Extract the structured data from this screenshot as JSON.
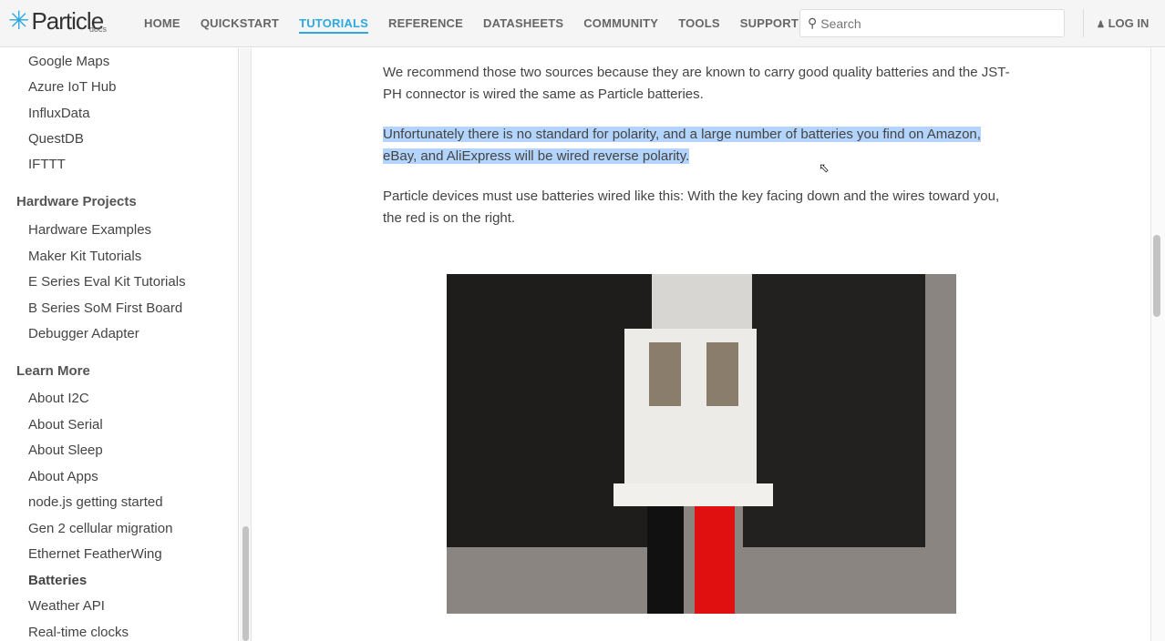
{
  "header": {
    "logo": "Particle",
    "logo_sub": "docs",
    "nav": [
      "HOME",
      "QUICKSTART",
      "TUTORIALS",
      "REFERENCE",
      "DATASHEETS",
      "COMMUNITY",
      "TOOLS",
      "SUPPORT"
    ],
    "active_nav": "TUTORIALS",
    "search_placeholder": "Search",
    "login": "LOG IN"
  },
  "sidebar": {
    "group1": [
      "Google Maps",
      "Azure IoT Hub",
      "InfluxData",
      "QuestDB",
      "IFTTT"
    ],
    "hardware_heading": "Hardware Projects",
    "hardware": [
      "Hardware Examples",
      "Maker Kit Tutorials",
      "E Series Eval Kit Tutorials",
      "B Series SoM First Board",
      "Debugger Adapter"
    ],
    "learn_heading": "Learn More",
    "learn": [
      "About I2C",
      "About Serial",
      "About Sleep",
      "About Apps",
      "node.js getting started",
      "Gen 2 cellular migration",
      "Ethernet FeatherWing",
      "Batteries",
      "Weather API",
      "Real-time clocks"
    ],
    "active": "Batteries"
  },
  "content": {
    "p1": "We recommend those two sources because they are known to carry good quality batteries and the JST-PH connector is wired the same as Particle batteries.",
    "p2": "Unfortunately there is no standard for polarity, and a large number of batteries you find on Amazon, eBay, and AliExpress will be wired reverse polarity.",
    "p3": "Particle devices must use batteries wired like this: With the key facing down and the wires toward you, the red is on the right."
  }
}
